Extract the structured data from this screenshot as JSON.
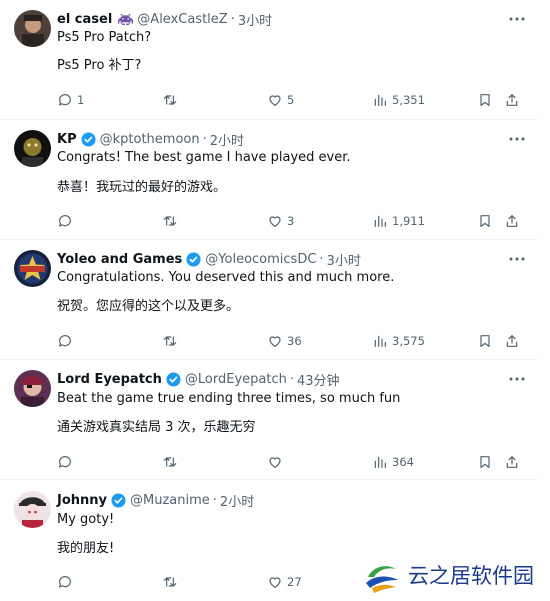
{
  "replies": [
    {
      "name": "el casel",
      "emoji_badge": "alien-invader-emoji",
      "verified": false,
      "handle": "@AlexCastleZ",
      "dot": "·",
      "time": "3小时",
      "lines": [
        "Ps5 Pro Patch?",
        "Ps5 Pro 补丁?"
      ],
      "stats": {
        "replies": "1",
        "reposts": "",
        "likes": "5",
        "views": "5,351"
      },
      "avatar_color": "#6b5a4e"
    },
    {
      "name": "KP",
      "verified": true,
      "handle": "@kptothemoon",
      "dot": "·",
      "time": "2小时",
      "lines": [
        "Congrats! The best game I have played ever.",
        "恭喜！我玩过的最好的游戏。"
      ],
      "stats": {
        "replies": "",
        "reposts": "",
        "likes": "3",
        "views": "1,911"
      },
      "avatar_color": "#1a1a1a"
    },
    {
      "name": "Yoleo and Games",
      "verified": true,
      "handle": "@YoleocomicsDC",
      "dot": "·",
      "time": "3小时",
      "lines": [
        "Congratulations. You deserved this and much more.",
        "祝贺。您应得的这个以及更多。"
      ],
      "stats": {
        "replies": "",
        "reposts": "",
        "likes": "36",
        "views": "3,575"
      },
      "avatar_color": "#1c2c5c"
    },
    {
      "name": "Lord Eyepatch",
      "verified": true,
      "handle": "@LordEyepatch",
      "dot": "·",
      "time": "43分钟",
      "lines": [
        "Beat the game true ending three times, so much fun",
        "通关游戏真实结局 3 次，乐趣无穷"
      ],
      "stats": {
        "replies": "",
        "reposts": "",
        "likes": "",
        "views": "364"
      },
      "avatar_color": "#6a3a5a"
    },
    {
      "name": "Johnny",
      "verified": true,
      "handle": "@Muzanime",
      "dot": "·",
      "time": "2小时",
      "lines": [
        "My goty!",
        "我的朋友!"
      ],
      "stats": {
        "replies": "",
        "reposts": "",
        "likes": "27",
        "views": ""
      },
      "avatar_color": "#f1e6ea"
    }
  ],
  "watermark": {
    "text": "云之居软件园"
  },
  "colors": {
    "text": "#0f1419",
    "muted": "#536471",
    "verified": "#1d9bf0",
    "divider": "#eff3f4"
  }
}
